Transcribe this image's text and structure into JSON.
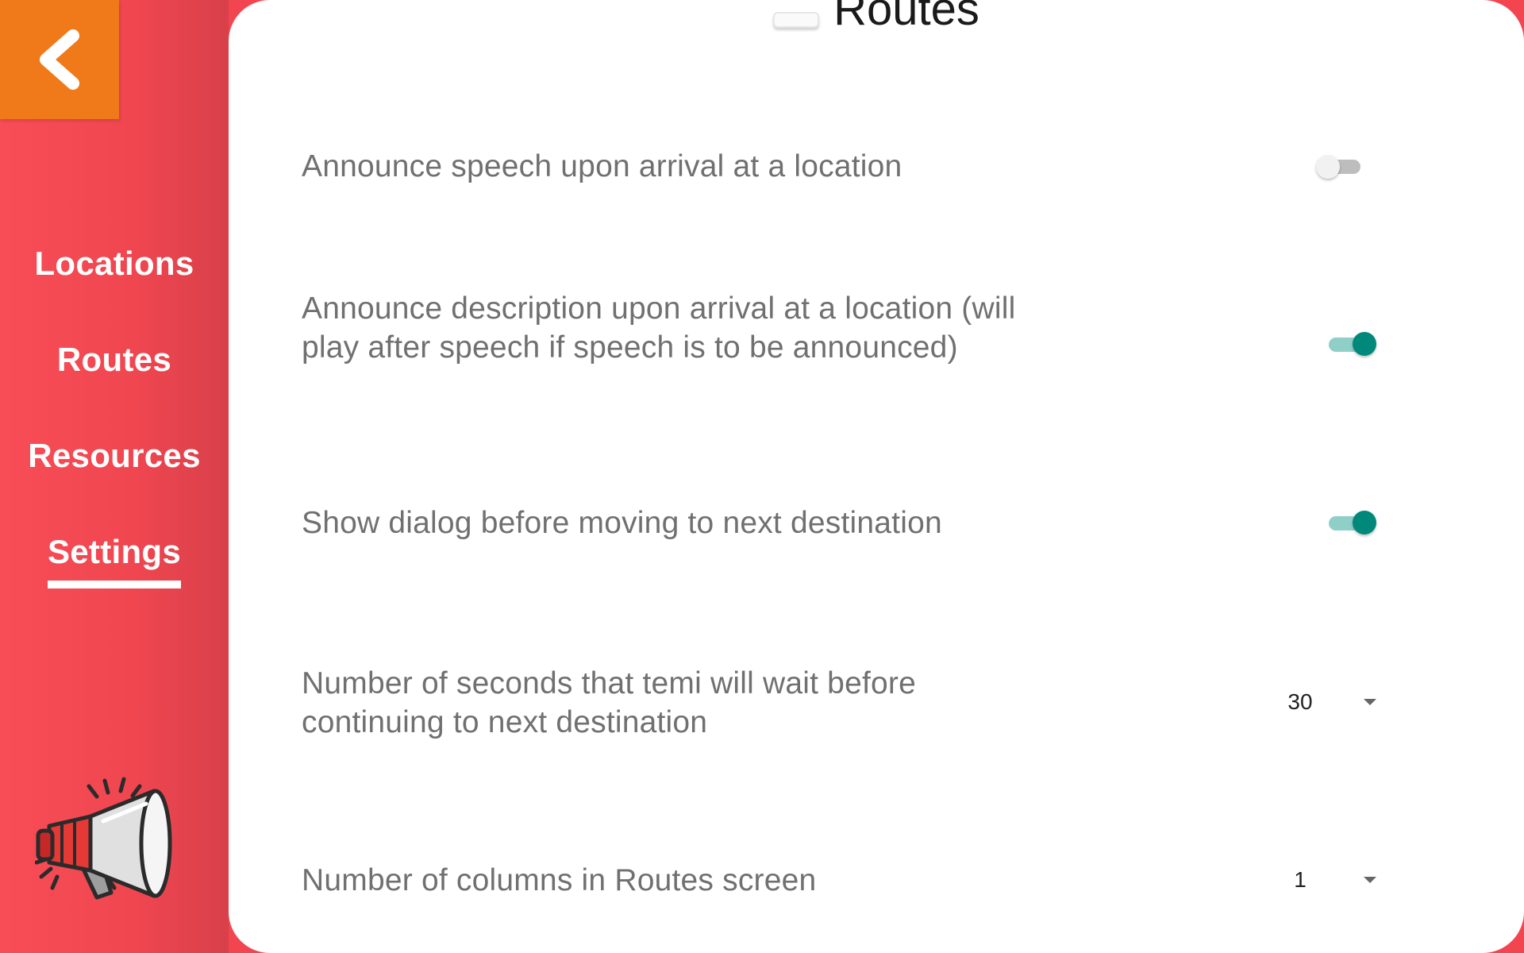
{
  "header": {
    "title": "Routes"
  },
  "sidebar": {
    "items": [
      {
        "label": "Locations"
      },
      {
        "label": "Routes"
      },
      {
        "label": "Resources"
      },
      {
        "label": "Settings",
        "active": true
      }
    ]
  },
  "icons": {
    "back": "chevron-left-icon",
    "logo": "megaphone-icon",
    "title_toggle": "toggle-icon"
  },
  "settings": {
    "announce_speech": {
      "label": "Announce speech upon arrival at a location",
      "enabled": false
    },
    "announce_description": {
      "label": "Announce description upon arrival at a location (will play after speech if speech is to be announced)",
      "enabled": true
    },
    "show_dialog": {
      "label": "Show dialog before moving to next destination",
      "enabled": true
    },
    "wait_seconds": {
      "label": "Number of seconds that temi will wait before continuing to next destination",
      "value": "30"
    },
    "route_columns": {
      "label": "Number of columns in Routes screen",
      "value": "1"
    }
  },
  "colors": {
    "sidebar": "#f2454f",
    "back_button": "#f07a1a",
    "switch_on": "#00897b",
    "switch_off": "#bdbdbd"
  }
}
